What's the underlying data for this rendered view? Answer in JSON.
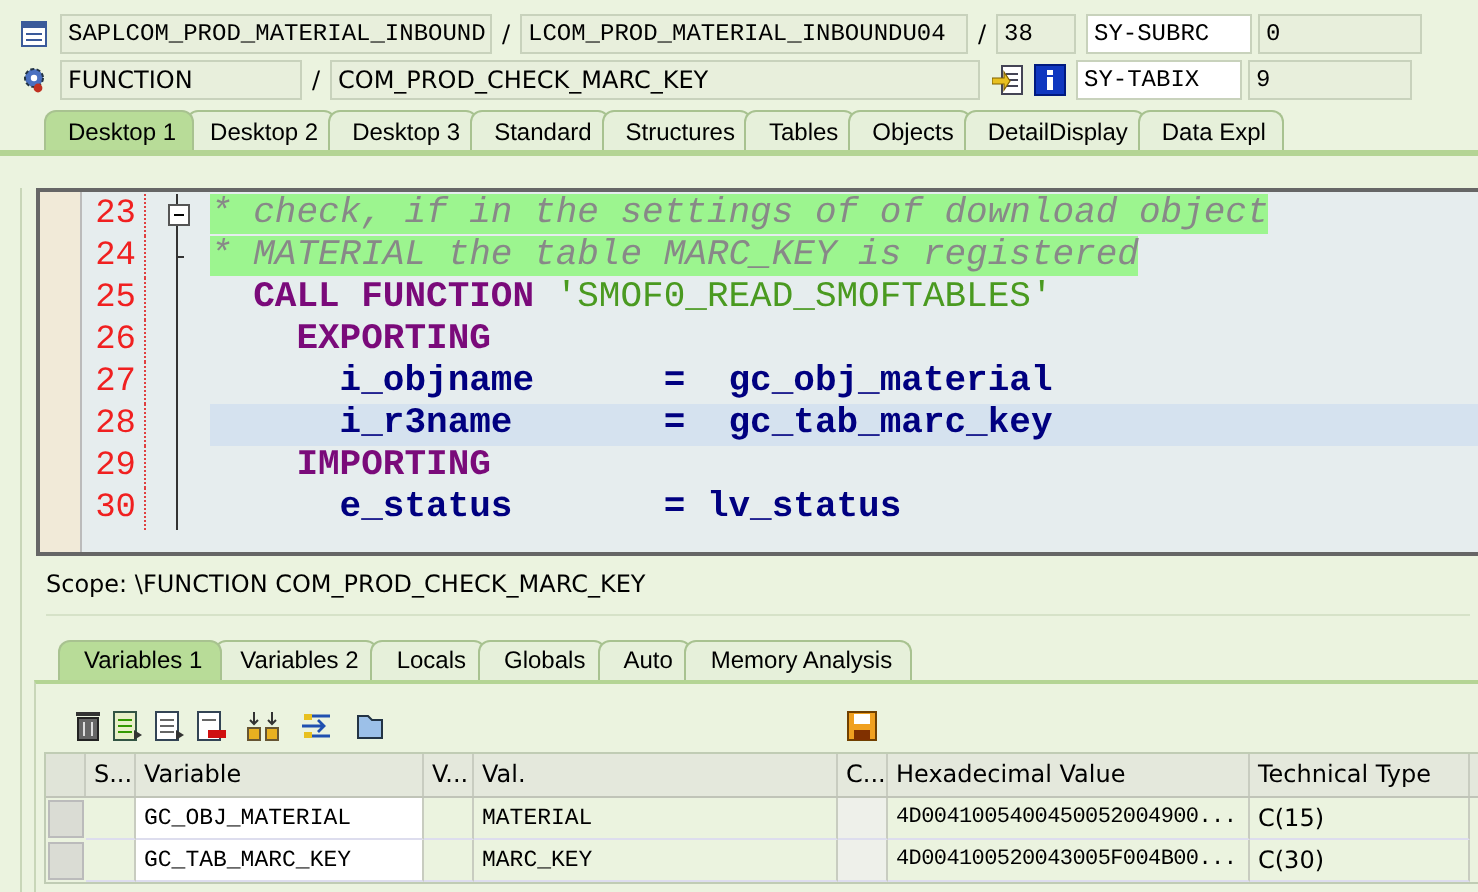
{
  "header": {
    "rows": [
      {
        "kind": "program",
        "program": "SAPLCOM_PROD_MATERIAL_INBOUND",
        "sep1": "/",
        "sep2": "/",
        "include": "LCOM_PROD_MATERIAL_INBOUNDU04",
        "line": "38",
        "field": "SY-SUBRC",
        "value": "0"
      },
      {
        "kind": "event",
        "type": "FUNCTION",
        "sep1": "/",
        "name": "COM_PROD_CHECK_MARC_KEY",
        "field": "SY-TABIX",
        "value": "9"
      }
    ]
  },
  "desktop_tabs": [
    {
      "label": "Desktop 1",
      "selected": true
    },
    {
      "label": "Desktop 2",
      "selected": false
    },
    {
      "label": "Desktop 3",
      "selected": false
    },
    {
      "label": "Standard",
      "selected": false
    },
    {
      "label": "Structures",
      "selected": false
    },
    {
      "label": "Tables",
      "selected": false
    },
    {
      "label": "Objects",
      "selected": false
    },
    {
      "label": "DetailDisplay",
      "selected": false
    },
    {
      "label": "Data Expl",
      "selected": false
    }
  ],
  "editor": {
    "lines": [
      {
        "number": "23",
        "current": false,
        "kind": "fold_start",
        "tokens": [
          {
            "kind": "comment",
            "text": "* check, if in the settings of of download object"
          }
        ]
      },
      {
        "number": "24",
        "current": false,
        "kind": "fold_end",
        "tokens": [
          {
            "kind": "comment",
            "text": "* MATERIAL the table MARC_KEY is registered"
          }
        ]
      },
      {
        "number": "25",
        "current": false,
        "tokens": [
          {
            "kind": "keyword",
            "text": "  CALL FUNCTION "
          },
          {
            "kind": "string",
            "text": "'SMOF0_READ_SMOFTABLES'"
          }
        ]
      },
      {
        "number": "26",
        "current": false,
        "tokens": [
          {
            "kind": "keyword",
            "text": "    EXPORTING"
          }
        ]
      },
      {
        "number": "27",
        "current": false,
        "tokens": [
          {
            "kind": "ident",
            "text": "      i_objname      =  gc_obj_material"
          }
        ]
      },
      {
        "number": "28",
        "current": true,
        "tokens": [
          {
            "kind": "ident",
            "text": "      i_r3name       =  gc_tab_marc_key"
          }
        ]
      },
      {
        "number": "29",
        "current": false,
        "tokens": [
          {
            "kind": "keyword",
            "text": "    IMPORTING"
          }
        ]
      },
      {
        "number": "30",
        "current": false,
        "tokens": [
          {
            "kind": "ident",
            "text": "      e_status       = lv_status"
          }
        ]
      }
    ]
  },
  "scope": "Scope: \\FUNCTION COM_PROD_CHECK_MARC_KEY",
  "variable_tabs": [
    {
      "label": "Variables 1",
      "selected": true
    },
    {
      "label": "Variables 2",
      "selected": false
    },
    {
      "label": "Locals",
      "selected": false
    },
    {
      "label": "Globals",
      "selected": false
    },
    {
      "label": "Auto",
      "selected": false
    },
    {
      "label": "Memory Analysis",
      "selected": false
    }
  ],
  "table": {
    "columns": [
      "S...",
      "Variable",
      "V...",
      "Val.",
      "C...",
      "Hexadecimal Value",
      "Technical Type"
    ],
    "rows": [
      {
        "cells": [
          "",
          "GC_OBJ_MATERIAL",
          "",
          "MATERIAL",
          "",
          "4D0041005400450052004900...",
          "C(15)"
        ]
      },
      {
        "cells": [
          "",
          "GC_TAB_MARC_KEY",
          "",
          "MARC_KEY",
          "",
          "4D004100520043005F004B00...",
          "C(30)"
        ]
      }
    ]
  }
}
